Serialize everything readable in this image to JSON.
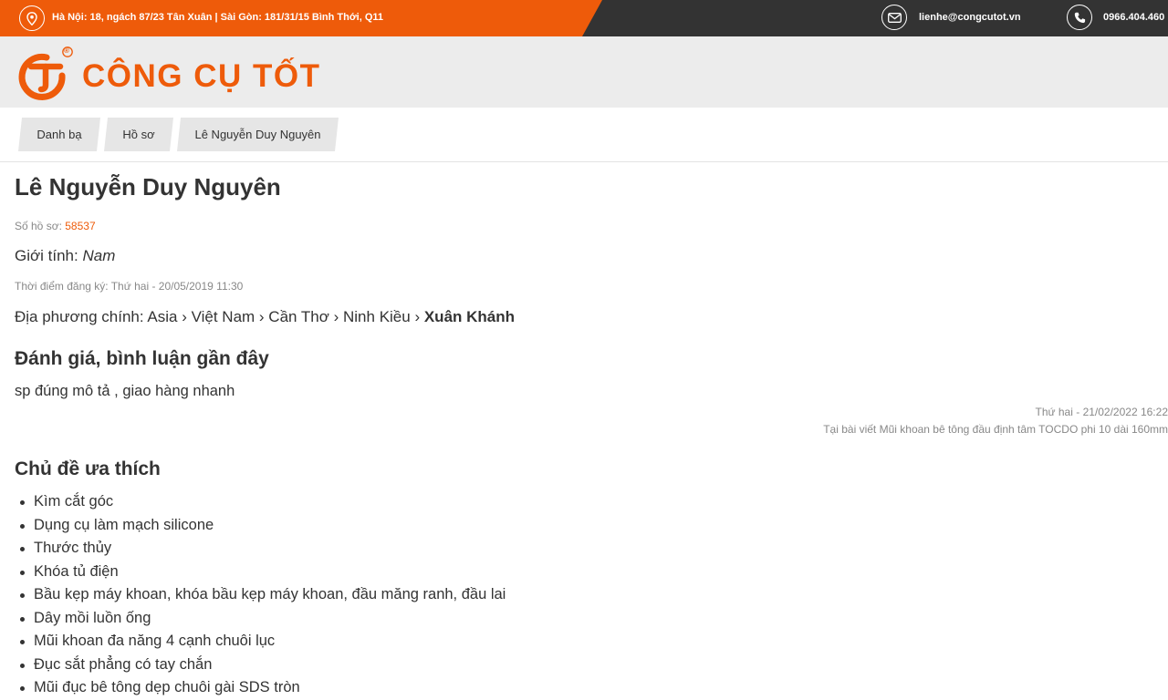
{
  "topbar": {
    "address": "Hà Nội: 18, ngách 87/23 Tân Xuân | Sài Gòn: 181/31/15 Bình Thới, Q11",
    "email": "lienhe@congcutot.vn",
    "phone": "0966.404.460",
    "icons": {
      "location": "map-pin-icon",
      "email": "envelope-icon",
      "phone": "phone-icon"
    }
  },
  "brand": {
    "name": "CÔNG CỤ TỐT",
    "registered": "®",
    "color": "#ee5b0a"
  },
  "breadcrumb": [
    "Danh bạ",
    "Hồ sơ",
    "Lê Nguyễn Duy Nguyên"
  ],
  "profile": {
    "name": "Lê Nguyễn Duy Nguyên",
    "id_label": "Số hồ sơ:",
    "id_value": "58537",
    "gender_label": "Giới tính:",
    "gender_value": "Nam",
    "registered_label": "Thời điểm đăng ký:",
    "registered_value": "Thứ hai - 20/05/2019 11:30",
    "location_label": "Địa phương chính:",
    "location_path": "Asia › Việt Nam › Cần Thơ › Ninh Kiều ›",
    "location_last": "Xuân Khánh"
  },
  "reviews": {
    "heading": "Đánh giá, bình luận gần đây",
    "items": [
      {
        "text": "sp đúng mô tả , giao hàng nhanh",
        "date": "Thứ hai - 21/02/2022 16:22",
        "post_label": "Tại bài viết",
        "post": "Mũi khoan bê tông đầu định tâm TOCDO phi 10 dài 160mm"
      }
    ]
  },
  "topics": {
    "heading": "Chủ đề ưa thích",
    "items": [
      "Kìm cắt góc",
      "Dụng cụ làm mạch silicone",
      "Thước thủy",
      "Khóa tủ điện",
      "Bầu kẹp máy khoan, khóa bầu kẹp máy khoan, đầu măng ranh, đầu lai",
      "Dây mồi luồn ống",
      "Mũi khoan đa năng 4 cạnh chuôi lục",
      "Đục sắt phẳng có tay chắn",
      "Mũi đục bê tông dẹp chuôi gài SDS tròn"
    ]
  }
}
